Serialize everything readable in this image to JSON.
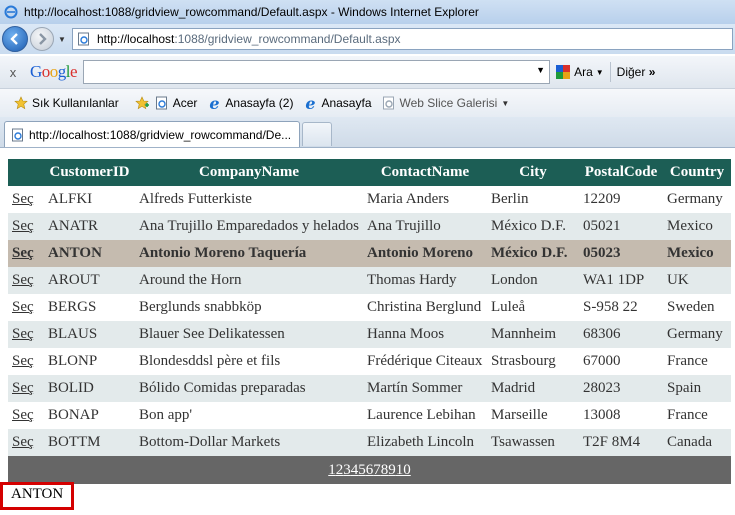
{
  "window": {
    "title": "http://localhost:1088/gridview_rowcommand/Default.aspx - Windows Internet Explorer"
  },
  "address_bar": {
    "host": "http://localhost",
    "path": ":1088/gridview_rowcommand/Default.aspx"
  },
  "google_toolbar": {
    "close": "x",
    "logo": "Google",
    "search_value": "",
    "search_label": "Ara",
    "more_label": "Diğer",
    "more_glyph": "»"
  },
  "favorites_bar": {
    "favorites_label": "Sık Kullanılanlar",
    "items": [
      {
        "label": "Acer"
      },
      {
        "label": "Anasayfa (2)"
      },
      {
        "label": "Anasayfa"
      },
      {
        "label": "Web Slice Galerisi"
      }
    ]
  },
  "tab": {
    "title": "http://localhost:1088/gridview_rowcommand/De..."
  },
  "grid": {
    "headers": [
      "",
      "CustomerID",
      "CompanyName",
      "ContactName",
      "City",
      "PostalCode",
      "Country"
    ],
    "select_label": "Seç",
    "selected_index": 2,
    "rows": [
      {
        "id": "ALFKI",
        "company": "Alfreds Futterkiste",
        "contact": "Maria Anders",
        "city": "Berlin",
        "postal": "12209",
        "country": "Germany"
      },
      {
        "id": "ANATR",
        "company": "Ana Trujillo Emparedados y helados",
        "contact": "Ana Trujillo",
        "city": "México D.F.",
        "postal": "05021",
        "country": "Mexico"
      },
      {
        "id": "ANTON",
        "company": "Antonio Moreno Taquería",
        "contact": "Antonio Moreno",
        "city": "México D.F.",
        "postal": "05023",
        "country": "Mexico"
      },
      {
        "id": "AROUT",
        "company": "Around the Horn",
        "contact": "Thomas Hardy",
        "city": "London",
        "postal": "WA1 1DP",
        "country": "UK"
      },
      {
        "id": "BERGS",
        "company": "Berglunds snabbköp",
        "contact": "Christina Berglund",
        "city": "Luleå",
        "postal": "S-958 22",
        "country": "Sweden"
      },
      {
        "id": "BLAUS",
        "company": "Blauer See Delikatessen",
        "contact": "Hanna Moos",
        "city": "Mannheim",
        "postal": "68306",
        "country": "Germany"
      },
      {
        "id": "BLONP",
        "company": "Blondesddsl père et fils",
        "contact": "Frédérique Citeaux",
        "city": "Strasbourg",
        "postal": "67000",
        "country": "France"
      },
      {
        "id": "BOLID",
        "company": "Bólido Comidas preparadas",
        "contact": "Martín Sommer",
        "city": "Madrid",
        "postal": "28023",
        "country": "Spain"
      },
      {
        "id": "BONAP",
        "company": "Bon app'",
        "contact": "Laurence Lebihan",
        "city": "Marseille",
        "postal": "13008",
        "country": "France"
      },
      {
        "id": "BOTTM",
        "company": "Bottom-Dollar Markets",
        "contact": "Elizabeth Lincoln",
        "city": "Tsawassen",
        "postal": "T2F 8M4",
        "country": "Canada"
      }
    ],
    "pager": [
      "1",
      "2",
      "3",
      "4",
      "5",
      "6",
      "7",
      "8",
      "9",
      "10"
    ]
  },
  "result_label": "ANTON",
  "colors": {
    "header_bg": "#1c5e55",
    "alt_row_bg": "#e3eaeb",
    "selected_row_bg": "#c5bbaf",
    "pager_bg": "#666666",
    "result_border": "#d40000"
  }
}
